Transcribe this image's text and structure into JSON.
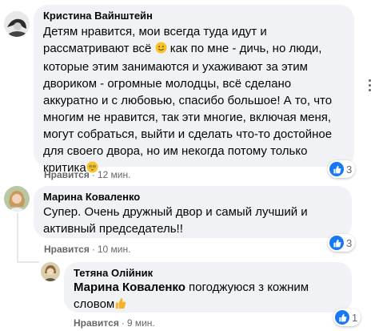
{
  "comments": [
    {
      "author": "Кристина Вайнштейн",
      "lines": [
        "Детям нравится, мои всегда туда идут и",
        "рассматривают всё",
        " как по мне - дичь, но люди,",
        "которые этим занимаются и ухаживают за этим",
        "двориком - огромные молодцы, всё сделано",
        "аккуратно и с любовью, спасибо большое! А то, что",
        "многим не нравится, так эти многие, включая меня,",
        "могут собраться, выйти и сделать что-то достойное",
        "для своего двора, но им некогда потому только",
        "критика"
      ],
      "like_label": "Нравится",
      "time": "12 мин.",
      "reaction_count": "3"
    },
    {
      "author": "Марина Коваленко",
      "lines": [
        "Супер. Очень дружный двор и самый лучший и",
        "активный председатель!!"
      ],
      "like_label": "Нравится",
      "time": "10 мин.",
      "reaction_count": "3"
    },
    {
      "author": "Тетяна Олійник",
      "mention": "Марина Коваленко",
      "lines": [
        " погоджуюся з кожним",
        "словом"
      ],
      "like_label": "Нравится",
      "time": "9 мин.",
      "reaction_count": "1"
    }
  ],
  "icons": {
    "reaction": "thumbs-up-icon",
    "more": "more-options-icon",
    "emoji_1": "smiling-face-icon",
    "emoji_2": "flushed-face-icon",
    "emoji_3": "thumbs-up-emoji-icon"
  },
  "colors": {
    "bubble": "#f0f2f5",
    "meta": "#65676b",
    "reaction_blue": "#1877f2"
  }
}
